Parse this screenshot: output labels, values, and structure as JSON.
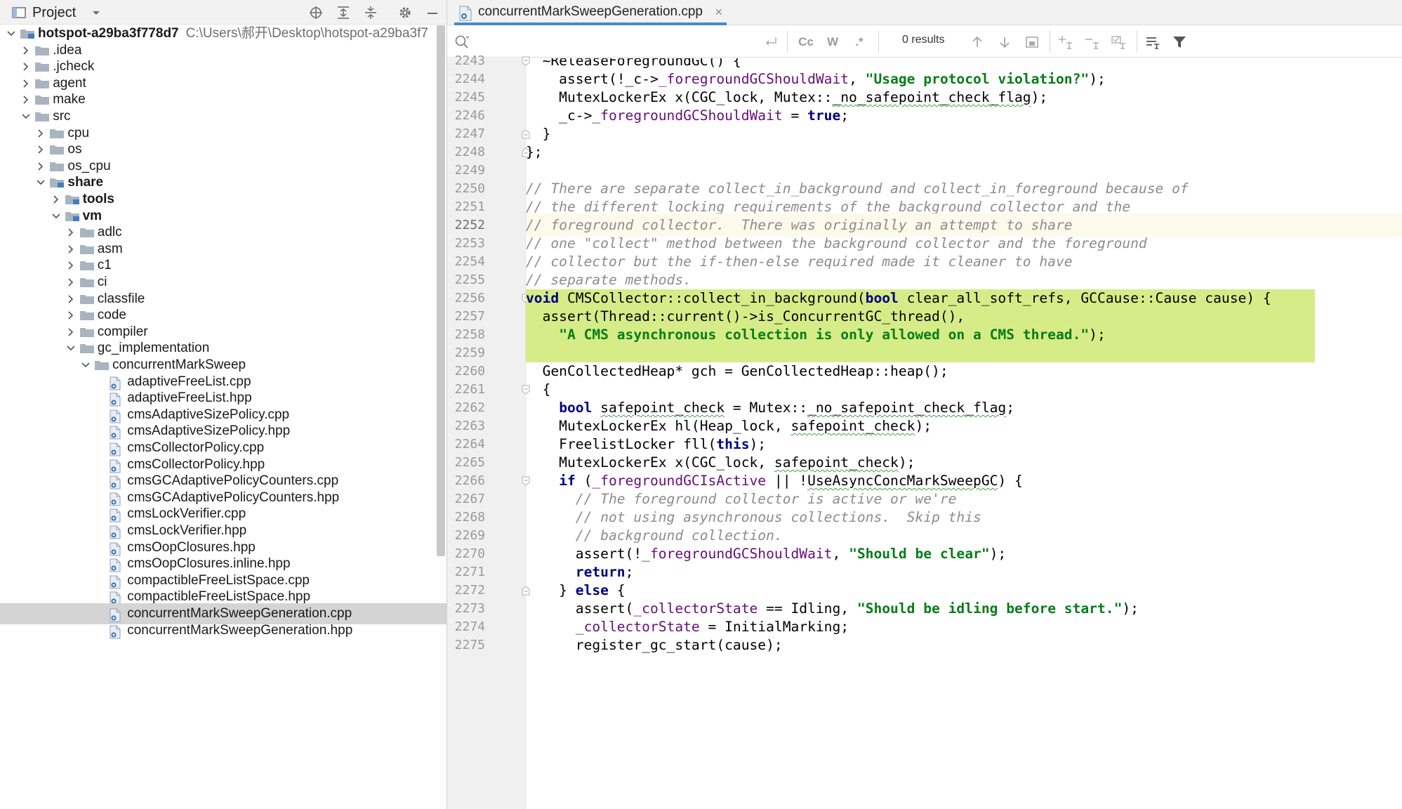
{
  "project_panel": {
    "title": "Project",
    "root": {
      "label": "hotspot-a29ba3f778d7",
      "path": "C:\\Users\\郝开\\Desktop\\hotspot-a29ba3f7"
    },
    "items": [
      {
        "label": ".idea",
        "depth": 1,
        "kind": "folder",
        "expanded": false
      },
      {
        "label": ".jcheck",
        "depth": 1,
        "kind": "folder",
        "expanded": false
      },
      {
        "label": "agent",
        "depth": 1,
        "kind": "folder",
        "expanded": false
      },
      {
        "label": "make",
        "depth": 1,
        "kind": "folder",
        "expanded": false
      },
      {
        "label": "src",
        "depth": 1,
        "kind": "folder",
        "expanded": true
      },
      {
        "label": "cpu",
        "depth": 2,
        "kind": "folder",
        "expanded": false
      },
      {
        "label": "os",
        "depth": 2,
        "kind": "folder",
        "expanded": false
      },
      {
        "label": "os_cpu",
        "depth": 2,
        "kind": "folder",
        "expanded": false
      },
      {
        "label": "share",
        "depth": 2,
        "kind": "folder-module",
        "expanded": true,
        "bold": true
      },
      {
        "label": "tools",
        "depth": 3,
        "kind": "folder-module",
        "expanded": false,
        "bold": true
      },
      {
        "label": "vm",
        "depth": 3,
        "kind": "folder-module",
        "expanded": true,
        "bold": true
      },
      {
        "label": "adlc",
        "depth": 4,
        "kind": "folder",
        "expanded": false
      },
      {
        "label": "asm",
        "depth": 4,
        "kind": "folder",
        "expanded": false
      },
      {
        "label": "c1",
        "depth": 4,
        "kind": "folder",
        "expanded": false
      },
      {
        "label": "ci",
        "depth": 4,
        "kind": "folder",
        "expanded": false
      },
      {
        "label": "classfile",
        "depth": 4,
        "kind": "folder",
        "expanded": false
      },
      {
        "label": "code",
        "depth": 4,
        "kind": "folder",
        "expanded": false
      },
      {
        "label": "compiler",
        "depth": 4,
        "kind": "folder",
        "expanded": false
      },
      {
        "label": "gc_implementation",
        "depth": 4,
        "kind": "folder",
        "expanded": true
      },
      {
        "label": "concurrentMarkSweep",
        "depth": 5,
        "kind": "folder",
        "expanded": true
      },
      {
        "label": "adaptiveFreeList.cpp",
        "depth": 6,
        "kind": "file"
      },
      {
        "label": "adaptiveFreeList.hpp",
        "depth": 6,
        "kind": "file"
      },
      {
        "label": "cmsAdaptiveSizePolicy.cpp",
        "depth": 6,
        "kind": "file"
      },
      {
        "label": "cmsAdaptiveSizePolicy.hpp",
        "depth": 6,
        "kind": "file"
      },
      {
        "label": "cmsCollectorPolicy.cpp",
        "depth": 6,
        "kind": "file"
      },
      {
        "label": "cmsCollectorPolicy.hpp",
        "depth": 6,
        "kind": "file"
      },
      {
        "label": "cmsGCAdaptivePolicyCounters.cpp",
        "depth": 6,
        "kind": "file"
      },
      {
        "label": "cmsGCAdaptivePolicyCounters.hpp",
        "depth": 6,
        "kind": "file"
      },
      {
        "label": "cmsLockVerifier.cpp",
        "depth": 6,
        "kind": "file"
      },
      {
        "label": "cmsLockVerifier.hpp",
        "depth": 6,
        "kind": "file"
      },
      {
        "label": "cmsOopClosures.hpp",
        "depth": 6,
        "kind": "file"
      },
      {
        "label": "cmsOopClosures.inline.hpp",
        "depth": 6,
        "kind": "file"
      },
      {
        "label": "compactibleFreeListSpace.cpp",
        "depth": 6,
        "kind": "file"
      },
      {
        "label": "compactibleFreeListSpace.hpp",
        "depth": 6,
        "kind": "file"
      },
      {
        "label": "concurrentMarkSweepGeneration.cpp",
        "depth": 6,
        "kind": "file",
        "selected": true
      },
      {
        "label": "concurrentMarkSweepGeneration.hpp",
        "depth": 6,
        "kind": "file"
      }
    ]
  },
  "editor": {
    "tab_label": "concurrentMarkSweepGeneration.cpp",
    "search": {
      "placeholder": "",
      "value": "",
      "results": "0 results",
      "case_label": "Cc",
      "word_label": "W",
      "regex_label": ".*"
    },
    "highlight_lines": [
      2256,
      2259
    ],
    "caret_line": 2252,
    "lines": [
      {
        "n": "2243",
        "fold": "top",
        "html": "  ~ReleaseForegroundGC() {"
      },
      {
        "n": "2244",
        "html": "    assert(!_c-><m>_foregroundGCShouldWait</m>, <s>\"Usage protocol violation?\"</s>);"
      },
      {
        "n": "2245",
        "html": "    MutexLockerEx x(CGC_lock, Mutex::<w>_no_safepoint_check_flag</w>);"
      },
      {
        "n": "2246",
        "html": "    _c-><m>_foregroundGCShouldWait</m> = <k>true</k>;"
      },
      {
        "n": "2247",
        "fold": "bottom",
        "html": "  }"
      },
      {
        "n": "2248",
        "fold": "bottom",
        "html": "};"
      },
      {
        "n": "2249",
        "html": ""
      },
      {
        "n": "2250",
        "html": "<c>// There are separate collect_in_background and collect_in_foreground because of</c>"
      },
      {
        "n": "2251",
        "html": "<c>// the different locking requirements of the background collector and the</c>"
      },
      {
        "n": "2252",
        "html": "<c>// foreground collector.  There was originally an attempt to share</c>"
      },
      {
        "n": "2253",
        "html": "<c>// one \"collect\" method between the background collector and the foreground</c>"
      },
      {
        "n": "2254",
        "html": "<c>// collector but the if-then-else required made it cleaner to have</c>"
      },
      {
        "n": "2255",
        "html": "<c>// separate methods.</c>"
      },
      {
        "n": "2256",
        "fold": "top",
        "html": "<k>void</k> CMSCollector::collect_in_background(<k>bool</k> clear_all_soft_refs, GCCause::Cause cause) {"
      },
      {
        "n": "2257",
        "html": "  assert(Thread::current()->is_ConcurrentGC_thread(),"
      },
      {
        "n": "2258",
        "html": "    <s>\"A CMS asynchronous collection is only allowed on a CMS thread.\"</s>);"
      },
      {
        "n": "2259",
        "html": ""
      },
      {
        "n": "2260",
        "html": "  GenCollectedHeap* gch = GenCollectedHeap::heap();"
      },
      {
        "n": "2261",
        "fold": "top",
        "html": "  {"
      },
      {
        "n": "2262",
        "html": "    <k>bool</k> <w>safepoint_check</w> = Mutex::<w>_no_safepoint_check_flag</w>;"
      },
      {
        "n": "2263",
        "html": "    MutexLockerEx hl(Heap_lock, <w>safepoint_check</w>);"
      },
      {
        "n": "2264",
        "html": "    FreelistLocker fll(<k>this</k>);"
      },
      {
        "n": "2265",
        "html": "    MutexLockerEx x(CGC_lock, <w>safepoint_check</w>);"
      },
      {
        "n": "2266",
        "fold": "top",
        "html": "    <k>if</k> (<m>_foregroundGCIsActive</m> || !<w>UseAsyncConcMarkSweepGC</w>) {"
      },
      {
        "n": "2267",
        "html": "      <c>// The foreground collector is active or we're</c>"
      },
      {
        "n": "2268",
        "html": "      <c>// not using asynchronous collections.  Skip this</c>"
      },
      {
        "n": "2269",
        "html": "      <c>// background collection.</c>"
      },
      {
        "n": "2270",
        "html": "      assert(!<m>_foregroundGCShouldWait</m>, <s>\"Should be clear\"</s>);"
      },
      {
        "n": "2271",
        "html": "      <k>return</k>;"
      },
      {
        "n": "2272",
        "fold": "bottom",
        "html": "    } <k>else</k> {"
      },
      {
        "n": "2273",
        "html": "      assert(<m>_collectorState</m> == Idling, <s>\"Should be idling before start.\"</s>);"
      },
      {
        "n": "2274",
        "html": "      <m>_collectorState</m> = InitialMarking;"
      },
      {
        "n": "2275",
        "html": "      register_gc_start(cause);"
      }
    ]
  }
}
